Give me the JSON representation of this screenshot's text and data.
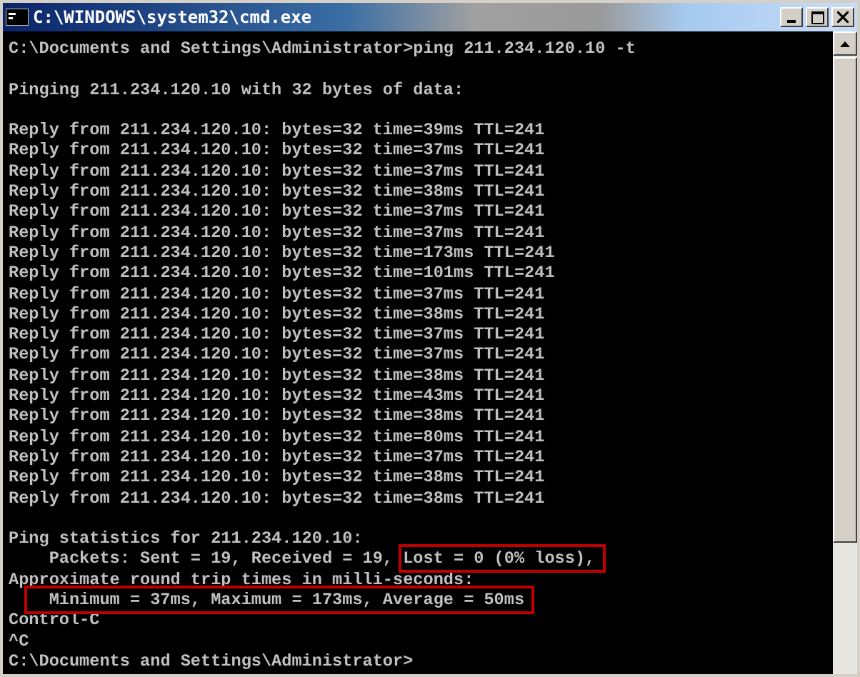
{
  "window": {
    "title": "C:\\WINDOWS\\system32\\cmd.exe"
  },
  "console": {
    "lines": [
      {
        "kind": "text",
        "text": "C:\\Documents and Settings\\Administrator>ping 211.234.120.10 -t"
      },
      {
        "kind": "blank"
      },
      {
        "kind": "text",
        "text": "Pinging 211.234.120.10 with 32 bytes of data:"
      },
      {
        "kind": "blank"
      },
      {
        "kind": "text",
        "text": "Reply from 211.234.120.10: bytes=32 time=39ms TTL=241"
      },
      {
        "kind": "text",
        "text": "Reply from 211.234.120.10: bytes=32 time=37ms TTL=241"
      },
      {
        "kind": "text",
        "text": "Reply from 211.234.120.10: bytes=32 time=37ms TTL=241"
      },
      {
        "kind": "text",
        "text": "Reply from 211.234.120.10: bytes=32 time=38ms TTL=241"
      },
      {
        "kind": "text",
        "text": "Reply from 211.234.120.10: bytes=32 time=37ms TTL=241"
      },
      {
        "kind": "text",
        "text": "Reply from 211.234.120.10: bytes=32 time=37ms TTL=241"
      },
      {
        "kind": "text",
        "text": "Reply from 211.234.120.10: bytes=32 time=173ms TTL=241"
      },
      {
        "kind": "text",
        "text": "Reply from 211.234.120.10: bytes=32 time=101ms TTL=241"
      },
      {
        "kind": "text",
        "text": "Reply from 211.234.120.10: bytes=32 time=37ms TTL=241"
      },
      {
        "kind": "text",
        "text": "Reply from 211.234.120.10: bytes=32 time=38ms TTL=241"
      },
      {
        "kind": "text",
        "text": "Reply from 211.234.120.10: bytes=32 time=37ms TTL=241"
      },
      {
        "kind": "text",
        "text": "Reply from 211.234.120.10: bytes=32 time=37ms TTL=241"
      },
      {
        "kind": "text",
        "text": "Reply from 211.234.120.10: bytes=32 time=38ms TTL=241"
      },
      {
        "kind": "text",
        "text": "Reply from 211.234.120.10: bytes=32 time=43ms TTL=241"
      },
      {
        "kind": "text",
        "text": "Reply from 211.234.120.10: bytes=32 time=38ms TTL=241"
      },
      {
        "kind": "text",
        "text": "Reply from 211.234.120.10: bytes=32 time=80ms TTL=241"
      },
      {
        "kind": "text",
        "text": "Reply from 211.234.120.10: bytes=32 time=37ms TTL=241"
      },
      {
        "kind": "text",
        "text": "Reply from 211.234.120.10: bytes=32 time=38ms TTL=241"
      },
      {
        "kind": "text",
        "text": "Reply from 211.234.120.10: bytes=32 time=38ms TTL=241"
      },
      {
        "kind": "blank"
      },
      {
        "kind": "text",
        "text": "Ping statistics for 211.234.120.10:"
      },
      {
        "kind": "text",
        "text": "    Packets: Sent = 19, Received = 19,",
        "marked": "Lost = 0 (0% loss),"
      },
      {
        "kind": "text",
        "text": "Approximate round trip times in milli-seconds:"
      },
      {
        "kind": "text",
        "marked": "  Minimum = 37ms, Maximum = 173ms, Average = 50ms"
      },
      {
        "kind": "text",
        "text": "Control-C"
      },
      {
        "kind": "text",
        "text": "^C"
      },
      {
        "kind": "text",
        "text": "C:\\Documents and Settings\\Administrator>"
      }
    ]
  }
}
